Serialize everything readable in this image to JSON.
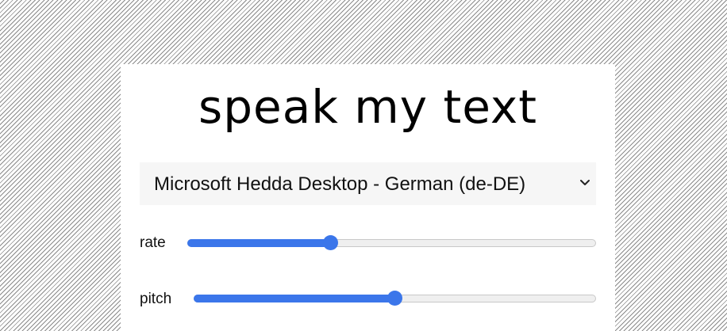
{
  "app": {
    "title": "speak my text"
  },
  "voice_select": {
    "selected": "Microsoft Hedda Desktop - German (de-DE)",
    "chevron_icon": "chevron-down-icon"
  },
  "rate": {
    "label": "rate",
    "fraction": 0.35
  },
  "pitch": {
    "label": "pitch",
    "fraction": 0.5
  },
  "colors": {
    "accent": "#3b76ea",
    "select_background": "#f6f6f6",
    "track": "#efefef"
  }
}
